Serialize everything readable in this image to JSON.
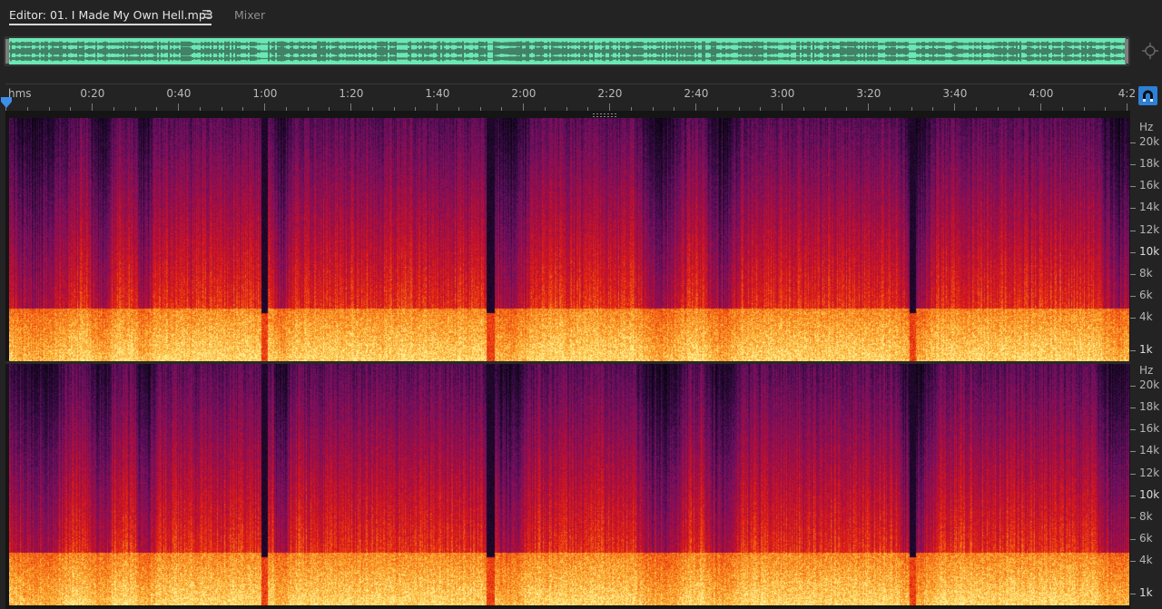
{
  "tabs": {
    "editor_label": "Editor: 01. I Made My Own Hell.mp3",
    "mixer_label": "Mixer"
  },
  "overview": {
    "waveform_color": "#6be8b4"
  },
  "ruler": {
    "unit_label": "hms",
    "time_labels": [
      "0:20",
      "0:40",
      "1:00",
      "1:20",
      "1:40",
      "2:00",
      "2:20",
      "2:40",
      "3:00",
      "3:20",
      "3:40",
      "4:00",
      "4:2"
    ]
  },
  "frequency_scale": {
    "unit_label": "Hz",
    "labels": [
      "20k",
      "18k",
      "16k",
      "14k",
      "12k",
      "10k",
      "8k",
      "6k",
      "4k",
      "1k"
    ]
  },
  "icons": {
    "tab_menu": "hamburger-menu-icon",
    "zoom_navigator": "zoom-navigator-icon",
    "snap": "magnet-snap-icon",
    "playhead": "playhead-marker-icon"
  },
  "colors": {
    "accent": "#2e7fd6",
    "background": "#232323"
  }
}
